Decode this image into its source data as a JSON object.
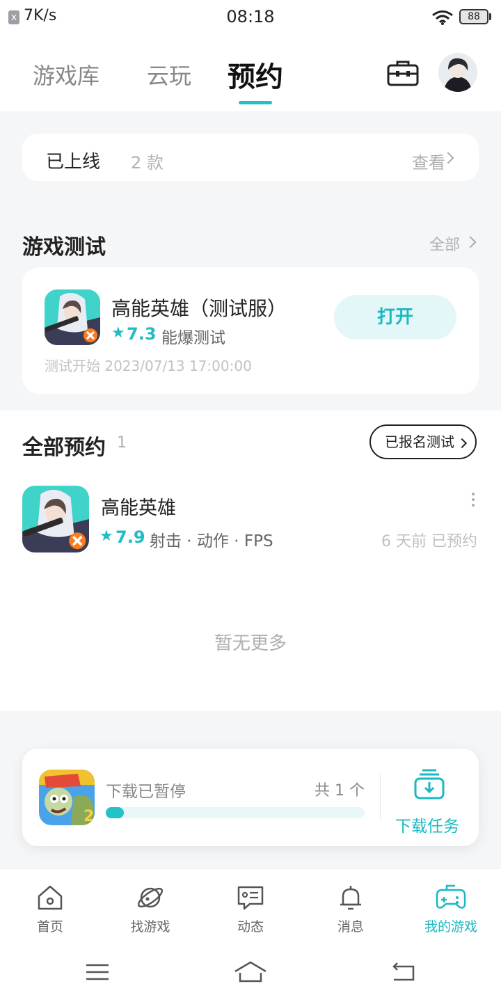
{
  "status_bar": {
    "net_badge": "x",
    "speed": "7K/s",
    "time": "08:18",
    "battery": "88"
  },
  "top_tabs": [
    {
      "label": "游戏库",
      "active": false
    },
    {
      "label": "云玩",
      "active": false
    },
    {
      "label": "预约",
      "active": true
    }
  ],
  "online": {
    "title": "已上线",
    "count": "2 款",
    "view_label": "查看"
  },
  "test_section": {
    "title": "游戏测试",
    "more_label": "全部",
    "game": {
      "name": "高能英雄（测试服）",
      "rating": "7.3",
      "tag": "能爆测试",
      "date": "测试开始 2023/07/13 17:00:00",
      "button_label": "打开"
    }
  },
  "all_section": {
    "title": "全部预约",
    "count": "1",
    "signed_btn": "已报名测试",
    "items": [
      {
        "name": "高能英雄",
        "rating": "7.9",
        "genres": "射击 · 动作 · FPS",
        "status": "6 天前 已预约"
      }
    ],
    "no_more": "暂无更多"
  },
  "download": {
    "title": "下载已暂停",
    "total": "共 1 个",
    "progress": 0.07,
    "task_label": "下载任务"
  },
  "bottom_nav": [
    {
      "label": "首页",
      "icon": "home-icon"
    },
    {
      "label": "找游戏",
      "icon": "planet-icon"
    },
    {
      "label": "动态",
      "icon": "chat-card-icon"
    },
    {
      "label": "消息",
      "icon": "bell-icon"
    },
    {
      "label": "我的游戏",
      "icon": "gamepad-icon",
      "active": true
    }
  ],
  "colors": {
    "accent": "#21c2c6",
    "background": "#f5f6f8"
  }
}
